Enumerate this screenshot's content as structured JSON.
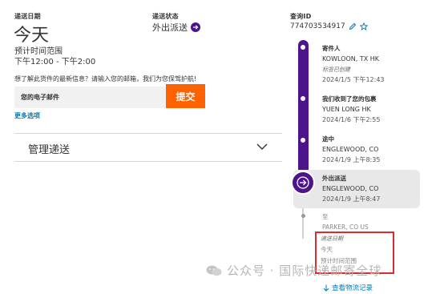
{
  "left": {
    "delivery_date_label": "递送日期",
    "delivery_date": "今天",
    "time_window_label": "预计时间范围",
    "time_window": "下午12:00 - 下午2:00",
    "prompt_text": "想了解此货件的最新信息？请输入您的邮箱，我们为您保驾护航!",
    "email_placeholder": "您的电子邮件",
    "submit_label": "提交",
    "more_options": "更多选项",
    "manage_delivery": "管理递送"
  },
  "status": {
    "label": "递送状态",
    "value": "外出派送"
  },
  "tracking": {
    "label": "查询ID",
    "id": "774703534917"
  },
  "timeline": {
    "events": [
      {
        "title": "寄件人",
        "location": "KOWLOON, TX HK",
        "sub": "标签已创建",
        "time": "2024/1/5 下午12:43"
      },
      {
        "title": "我们收到了您的包裹",
        "location": "YUEN LONG HK",
        "time": "2024/1/6 下午2:55"
      },
      {
        "title": "途中",
        "location": "ENGLEWOOD, CO",
        "time": "2024/1/9 上午8:35"
      },
      {
        "title": "外出派送",
        "location": "ENGLEWOOD, CO",
        "time": "2024/1/9 上午8:47"
      }
    ],
    "destination_label": "至",
    "destination": "PARKER, CO US",
    "delivery_date_label": "递送日期",
    "delivery_date": "今天",
    "time_window_label": "预计时间范围",
    "view_history": "查看物流记录"
  },
  "watermark": {
    "text": "公众号 · 国际快递邮寄全球"
  },
  "colors": {
    "brand_purple": "#4d148c",
    "brand_orange": "#ff6200",
    "link_blue": "#007ab7",
    "highlight_red": "#e0292b"
  }
}
